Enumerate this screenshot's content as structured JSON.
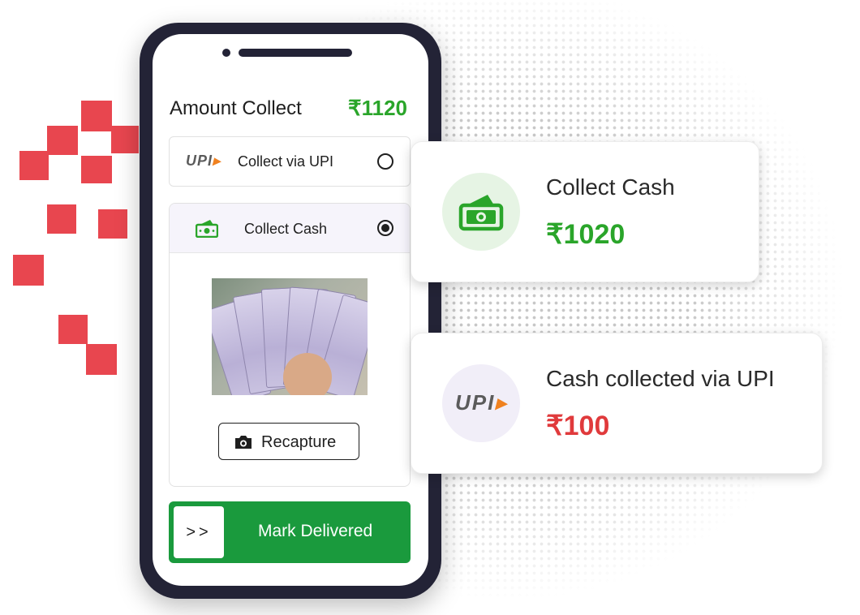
{
  "phone": {
    "amount_label": "Amount Collect",
    "amount_value": "₹1120",
    "upi_option": {
      "logo": "UPI",
      "label": "Collect via UPI",
      "selected": false
    },
    "cash_option": {
      "label": "Collect Cash",
      "selected": true,
      "icon": "cash-icon"
    },
    "recapture_label": "Recapture",
    "deliver": {
      "handle": ">>",
      "label": "Mark Delivered"
    }
  },
  "cards": {
    "cash": {
      "title": "Collect Cash",
      "value": "₹1020",
      "icon": "cash-icon"
    },
    "upi": {
      "title": "Cash collected via UPI",
      "value": "₹100",
      "logo": "UPI"
    }
  },
  "colors": {
    "green": "#2aa52a",
    "button_green": "#1a9a3d",
    "red": "#e03a3c",
    "phone_frame": "#232336",
    "pixel_red": "#e8464f"
  }
}
